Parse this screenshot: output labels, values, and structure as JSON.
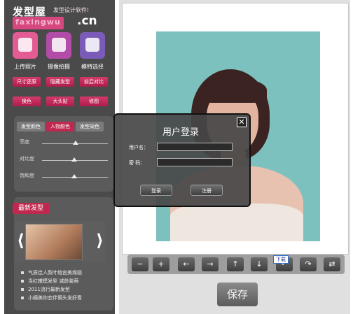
{
  "logo": {
    "title": "发型屋",
    "subtitle": "发型设计软件!",
    "url": "faxingwu",
    "suffix": ".cn"
  },
  "tools": [
    {
      "label": "上传照片",
      "icon": "upload-photo-icon"
    },
    {
      "label": "摄像拍摄",
      "icon": "camera-icon"
    },
    {
      "label": "模特选择",
      "icon": "model-select-icon"
    }
  ],
  "action_buttons": [
    "尺寸还原",
    "隐藏发型",
    "前后对比",
    "换色",
    "大头贴",
    "修图"
  ],
  "color_tabs": [
    "发型颜色",
    "人物颜色",
    "发型染色"
  ],
  "sliders": [
    "亮度",
    "对比度",
    "饱和度"
  ],
  "news": {
    "heading": "最新发型",
    "items": [
      "气质佳人梨叶络宫美绵丽",
      "当红嫩模发型 减龄装萌",
      "2011流行最新发型",
      "小嫡美你恋伴俩头发好看"
    ]
  },
  "toolbar": {
    "tooltip": "下载"
  },
  "save_label": "保存",
  "dialog": {
    "title": "用户登录",
    "close": "✕",
    "username_label": "用户名：",
    "password_label": "密 码：",
    "username_value": "",
    "password_value": "",
    "login_label": "登录",
    "register_label": "注册"
  },
  "colors": {
    "accent": "#c0284f",
    "panel": "#4a4a4a",
    "photo_bg": "#7cc1bd"
  }
}
